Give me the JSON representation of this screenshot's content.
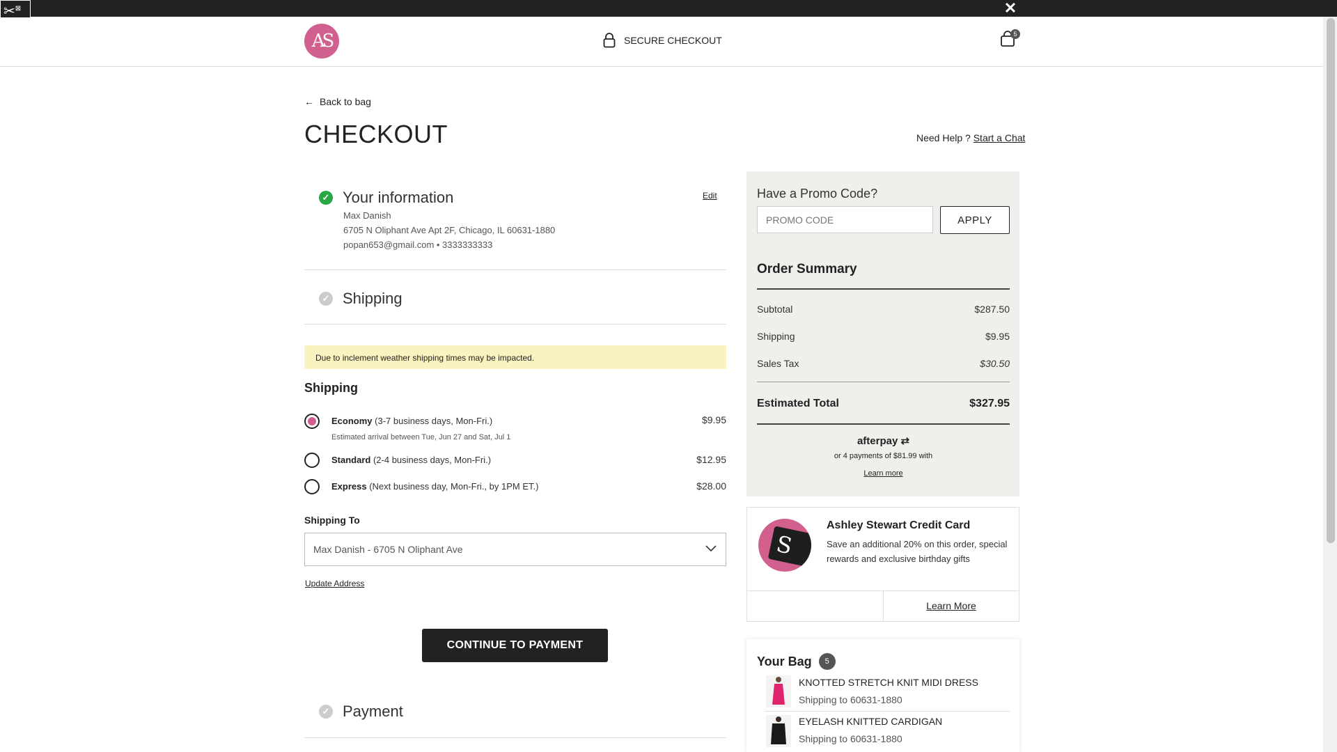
{
  "toolbar": {
    "close_label": "✕"
  },
  "header": {
    "logo_text": "AS",
    "secure_label": "SECURE CHECKOUT",
    "cart_count": "5"
  },
  "nav": {
    "back_label": "Back to bag"
  },
  "page": {
    "title": "CHECKOUT",
    "help_prefix": "Need Help ?",
    "help_link": "Start a Chat"
  },
  "your_info": {
    "title": "Your information",
    "edit_label": "Edit",
    "name": "Max Danish",
    "address": "6705 N Oliphant Ave Apt 2F, Chicago, IL 60631-1880",
    "contact": "popan653@gmail.com • 3333333333"
  },
  "shipping_section": {
    "title": "Shipping"
  },
  "notice": "Due to inclement weather shipping times may be impacted.",
  "shipping": {
    "heading": "Shipping",
    "options": [
      {
        "name": "Economy",
        "desc": "(3-7 business days, Mon-Fri.)",
        "price": "$9.95",
        "selected": true
      },
      {
        "name": "Standard",
        "desc": "(2-4 business days, Mon-Fri.)",
        "price": "$12.95",
        "selected": false
      },
      {
        "name": "Express",
        "desc": "(Next business day, Mon-Fri., by 1PM ET.)",
        "price": "$28.00",
        "selected": false
      }
    ],
    "arrival": "Estimated arrival between Tue, Jun 27 and Sat, Jul 1",
    "ship_to_label": "Shipping To",
    "ship_to_value": "Max Danish - 6705 N Oliphant Ave",
    "update_label": "Update Address",
    "continue_label": "CONTINUE TO PAYMENT"
  },
  "payment_section": {
    "title": "Payment"
  },
  "promo": {
    "heading": "Have a Promo Code?",
    "placeholder": "PROMO CODE",
    "apply_label": "APPLY"
  },
  "summary": {
    "heading": "Order Summary",
    "subtotal_label": "Subtotal",
    "subtotal": "$287.50",
    "shipping_label": "Shipping",
    "shipping": "$9.95",
    "tax_label": "Sales Tax",
    "tax": "$30.50",
    "total_label": "Estimated Total",
    "total": "$327.95"
  },
  "afterpay": {
    "brand": "afterpay",
    "text": "or 4 payments of $81.99 with",
    "learn": "Learn more"
  },
  "credit_card": {
    "title": "Ashley Stewart Credit Card",
    "text": "Save an additional 20% on this order, special rewards and exclusive birthday gifts",
    "learn_label": "Learn More"
  },
  "bag": {
    "title": "Your Bag",
    "count": "5",
    "items": [
      {
        "name": "KNOTTED STRETCH KNIT MIDI DRESS",
        "shipping": "Shipping to 60631-1880"
      },
      {
        "name": "EYELASH KNITTED CARDIGAN",
        "shipping": "Shipping to 60631-1880"
      }
    ]
  },
  "colors": {
    "brand_pink": "#d2608f",
    "success_green": "#28a745",
    "notice_yellow": "#fbf3bf"
  }
}
